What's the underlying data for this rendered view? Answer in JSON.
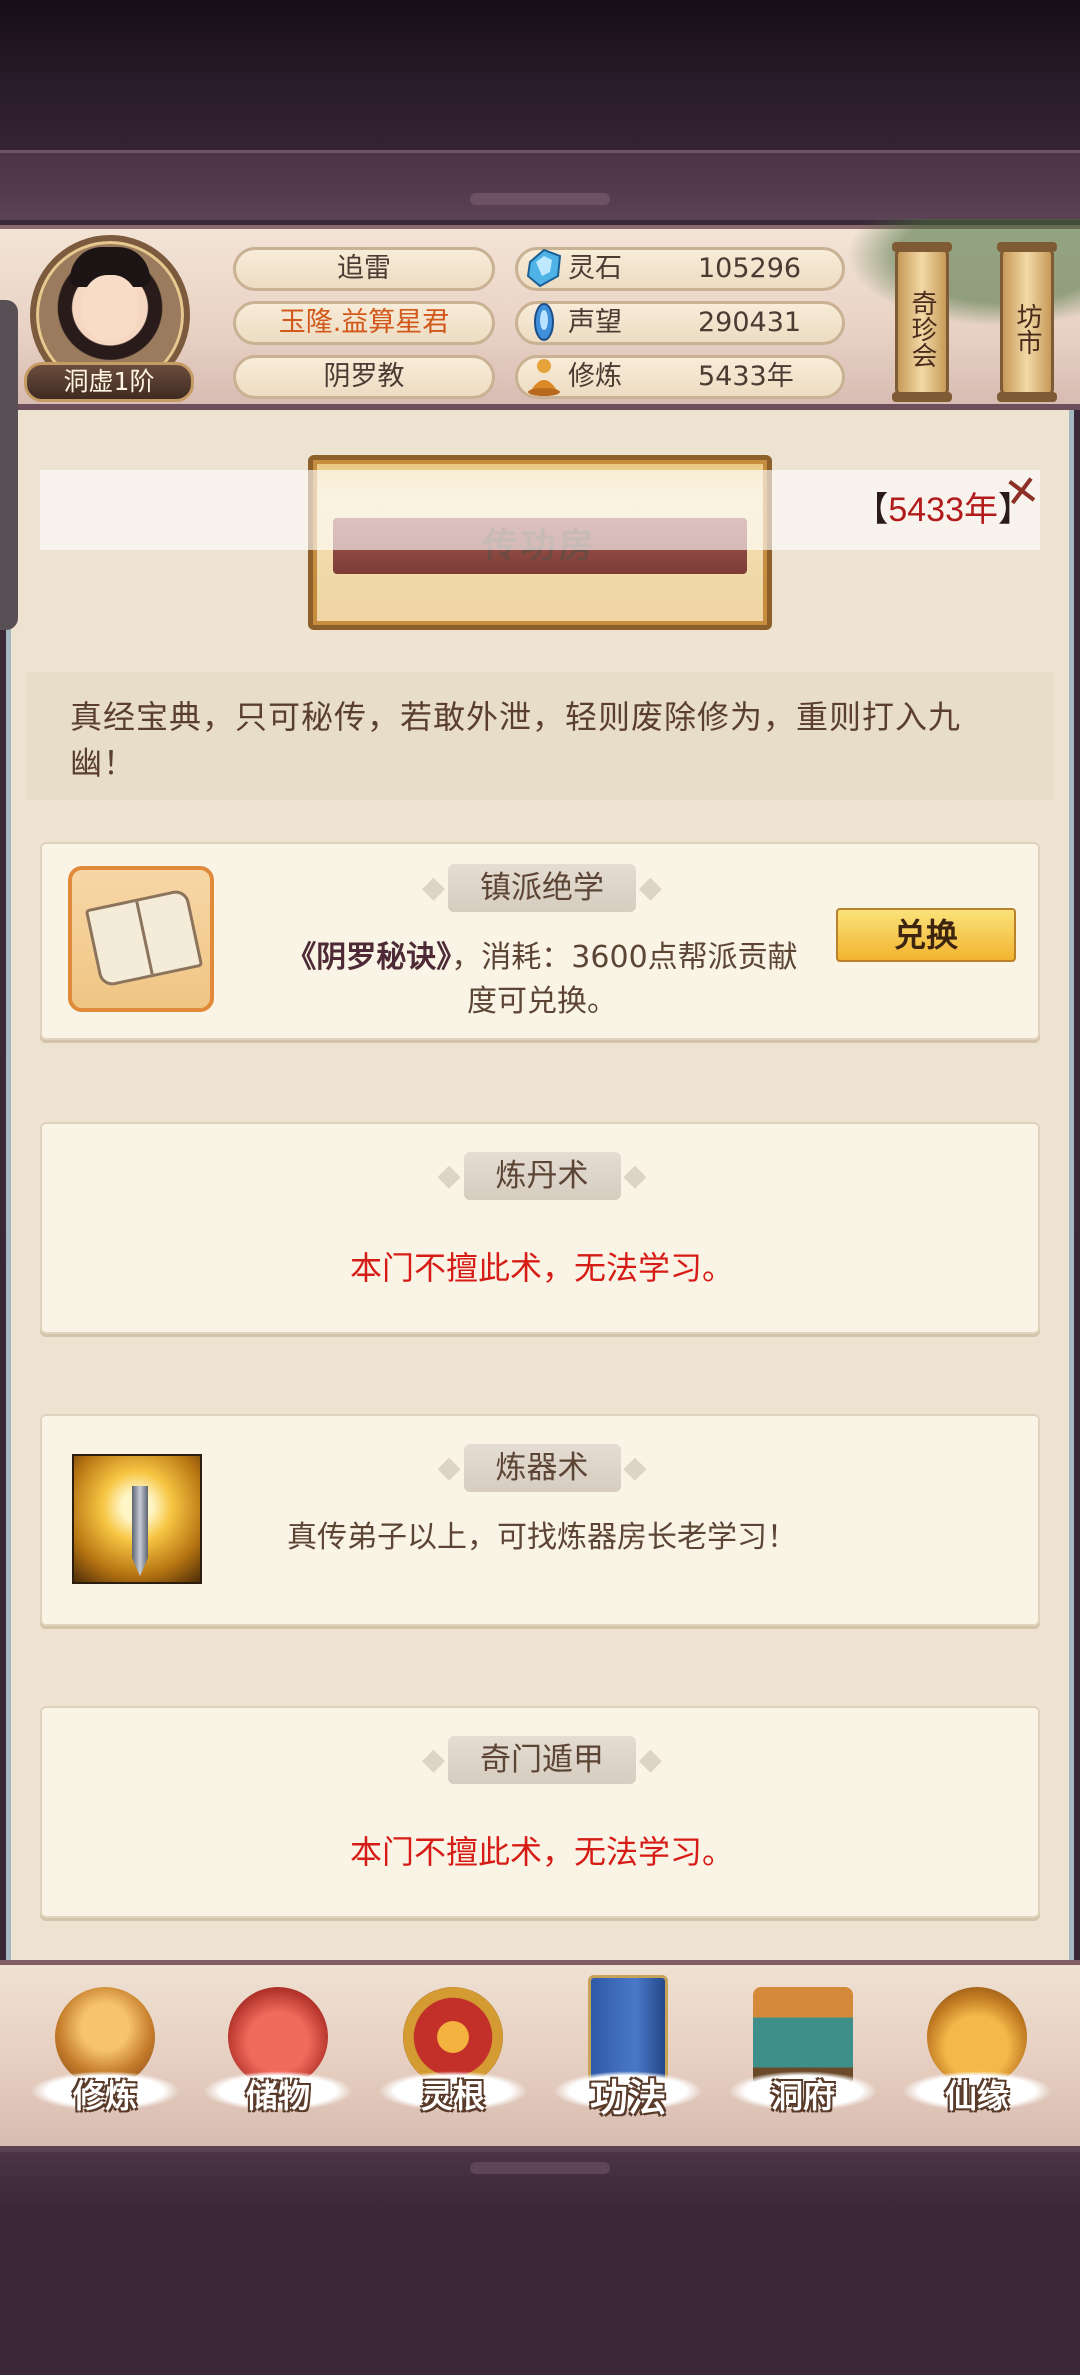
{
  "header": {
    "player_name": "追雷",
    "player_title": "玉隆.益算星君",
    "sect": "阴罗教",
    "rank": "洞虚1阶",
    "stats": [
      {
        "icon": "spirit-stone-icon",
        "label": "灵石",
        "value": "105296"
      },
      {
        "icon": "reputation-icon",
        "label": "声望",
        "value": "290431"
      },
      {
        "icon": "cultivation-icon",
        "label": "修炼",
        "value": "5433年"
      }
    ],
    "side_buttons": [
      "奇珍会",
      "坊市"
    ]
  },
  "page": {
    "title": "传功房",
    "year_value": "5433年",
    "bracket_open": "【",
    "bracket_close": "】",
    "intro": "真经宝典，只可秘传，若敢外泄，轻则废除修为，重则打入九幽！"
  },
  "cards": [
    {
      "title": "镇派绝学",
      "book_name": "《阴罗秘诀》",
      "body": "，消耗：3600点帮派贡献度可兑换。",
      "button": "兑换"
    },
    {
      "title": "炼丹术",
      "body": "本门不擅此术，无法学习。"
    },
    {
      "title": "炼器术",
      "body": "真传弟子以上，可找炼器房长老学习！"
    },
    {
      "title": "奇门遁甲",
      "body": "本门不擅此术，无法学习。"
    }
  ],
  "nav": [
    {
      "label": "修炼",
      "icon": "meditation-icon"
    },
    {
      "label": "储物",
      "icon": "pouch-icon"
    },
    {
      "label": "灵根",
      "icon": "spirit-root-icon"
    },
    {
      "label": "功法",
      "icon": "scripture-icon",
      "active": true
    },
    {
      "label": "洞府",
      "icon": "cave-house-icon"
    },
    {
      "label": "仙缘",
      "icon": "gourd-icon"
    }
  ],
  "colors": {
    "accent_red": "#d61c16",
    "title_orange": "#d3581b",
    "parchment": "#ede3d0"
  }
}
